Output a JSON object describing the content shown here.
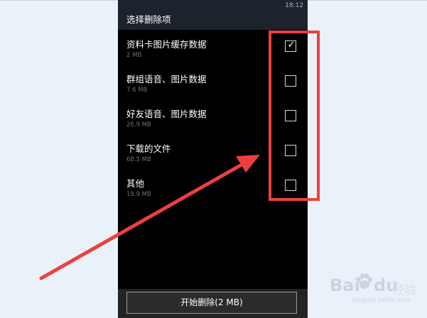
{
  "status_bar": {
    "time": "18:12"
  },
  "header": {
    "title": "选择删除项"
  },
  "items": [
    {
      "label": "资料卡图片缓存数据",
      "size": "2 MB",
      "checked": true
    },
    {
      "label": "群组语音、图片数据",
      "size": "7.6 MB",
      "checked": false
    },
    {
      "label": "好友语音、图片数据",
      "size": "26.9 MB",
      "checked": false
    },
    {
      "label": "下载的文件",
      "size": "68.5 MB",
      "checked": false
    },
    {
      "label": "其他",
      "size": "19.9 MB",
      "checked": false
    }
  ],
  "checkmark_glyph": "✓",
  "actions": {
    "delete_label": "开始删除(2 MB)"
  },
  "annotation": {
    "color": "#ee3f3f"
  },
  "watermark": {
    "brand_left": "Bai",
    "brand_right": "du",
    "product": "经验",
    "url": "jingyan.baidu.com"
  }
}
